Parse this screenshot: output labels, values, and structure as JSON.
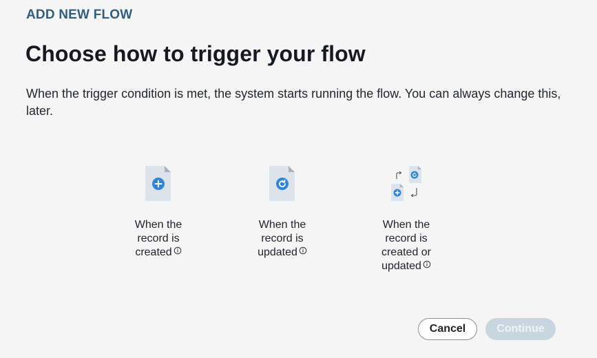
{
  "header": {
    "eyebrow": "ADD NEW FLOW",
    "title": "Choose how to trigger your flow",
    "description": "When the trigger condition is met, the system starts running the flow. You can always change this, later."
  },
  "options": [
    {
      "line1": "When the",
      "line2": "record is",
      "line3": "created",
      "line4": "",
      "icon": "document-plus-icon"
    },
    {
      "line1": "When the",
      "line2": "record is",
      "line3": "updated",
      "line4": "",
      "icon": "document-refresh-icon"
    },
    {
      "line1": "When the",
      "line2": "record is",
      "line3": "created or",
      "line4": "updated",
      "icon": "documents-swap-icon"
    }
  ],
  "footer": {
    "cancel_label": "Cancel",
    "continue_label": "Continue"
  },
  "colors": {
    "background": "#f4f5f4",
    "eyebrow": "#2f5f80",
    "icon_blue": "#2f86d8",
    "doc_fill": "#dde3ea",
    "continue_disabled": "#c8d6df"
  }
}
